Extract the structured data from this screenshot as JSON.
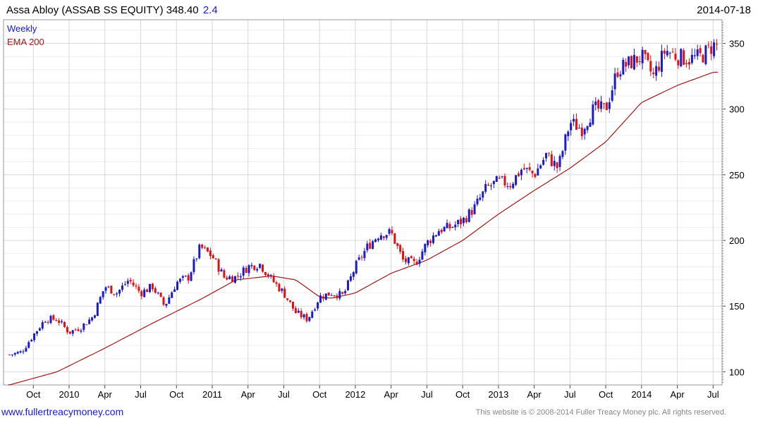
{
  "header": {
    "name": "Assa Abloy (ASSAB SS EQUITY)",
    "price": "348.40",
    "change": "2.4",
    "date": "2014-07-18"
  },
  "footer": {
    "site": "www.fullertreacymoney.com",
    "copyright": "This website is © 2008-2014 Fuller Treacy Money plc. All rights reserved."
  },
  "colors": {
    "up": "#1a1acd",
    "down": "#dd1111",
    "ema": "#a01818",
    "grid": "#d8d8d8"
  },
  "chart_data": {
    "type": "candlestick",
    "legend": [
      {
        "label": "Weekly",
        "color": "#1a1acd"
      },
      {
        "label": "EMA 200",
        "color": "#a01818"
      }
    ],
    "ylim": [
      90,
      368
    ],
    "y_ticks": [
      100,
      150,
      200,
      250,
      300,
      350
    ],
    "x_ticks": [
      "Oct",
      "2010",
      "Apr",
      "Jul",
      "Oct",
      "2011",
      "Apr",
      "Jul",
      "Oct",
      "2012",
      "Apr",
      "Jul",
      "Oct",
      "2013",
      "Apr",
      "Jul",
      "Oct",
      "2014",
      "Apr",
      "Jul"
    ],
    "close_series": [
      {
        "x": "2009-08",
        "y": 113
      },
      {
        "x": "2009-09",
        "y": 115
      },
      {
        "x": "2009-10",
        "y": 128
      },
      {
        "x": "2009-11",
        "y": 140
      },
      {
        "x": "2009-12",
        "y": 140
      },
      {
        "x": "2010-01",
        "y": 130
      },
      {
        "x": "2010-02",
        "y": 134
      },
      {
        "x": "2010-03",
        "y": 142
      },
      {
        "x": "2010-04",
        "y": 165
      },
      {
        "x": "2010-05",
        "y": 160
      },
      {
        "x": "2010-06",
        "y": 170
      },
      {
        "x": "2010-07",
        "y": 160
      },
      {
        "x": "2010-08",
        "y": 165
      },
      {
        "x": "2010-09",
        "y": 150
      },
      {
        "x": "2010-10",
        "y": 168
      },
      {
        "x": "2010-11",
        "y": 172
      },
      {
        "x": "2010-12",
        "y": 195
      },
      {
        "x": "2011-01",
        "y": 188
      },
      {
        "x": "2011-02",
        "y": 172
      },
      {
        "x": "2011-03",
        "y": 172
      },
      {
        "x": "2011-04",
        "y": 180
      },
      {
        "x": "2011-05",
        "y": 182
      },
      {
        "x": "2011-06",
        "y": 170
      },
      {
        "x": "2011-07",
        "y": 160
      },
      {
        "x": "2011-08",
        "y": 145
      },
      {
        "x": "2011-09",
        "y": 140
      },
      {
        "x": "2011-10",
        "y": 157
      },
      {
        "x": "2011-11",
        "y": 160
      },
      {
        "x": "2011-12",
        "y": 158
      },
      {
        "x": "2012-01",
        "y": 180
      },
      {
        "x": "2012-02",
        "y": 195
      },
      {
        "x": "2012-03",
        "y": 205
      },
      {
        "x": "2012-04",
        "y": 206
      },
      {
        "x": "2012-05",
        "y": 185
      },
      {
        "x": "2012-06",
        "y": 182
      },
      {
        "x": "2012-07",
        "y": 198
      },
      {
        "x": "2012-08",
        "y": 208
      },
      {
        "x": "2012-09",
        "y": 210
      },
      {
        "x": "2012-10",
        "y": 215
      },
      {
        "x": "2012-11",
        "y": 225
      },
      {
        "x": "2012-12",
        "y": 240
      },
      {
        "x": "2013-01",
        "y": 245
      },
      {
        "x": "2013-02",
        "y": 243
      },
      {
        "x": "2013-03",
        "y": 255
      },
      {
        "x": "2013-04",
        "y": 250
      },
      {
        "x": "2013-05",
        "y": 265
      },
      {
        "x": "2013-06",
        "y": 255
      },
      {
        "x": "2013-07",
        "y": 290
      },
      {
        "x": "2013-08",
        "y": 285
      },
      {
        "x": "2013-09",
        "y": 300
      },
      {
        "x": "2013-10",
        "y": 300
      },
      {
        "x": "2013-11",
        "y": 330
      },
      {
        "x": "2013-12",
        "y": 335
      },
      {
        "x": "2014-01",
        "y": 340
      },
      {
        "x": "2014-02",
        "y": 325
      },
      {
        "x": "2014-03",
        "y": 345
      },
      {
        "x": "2014-04",
        "y": 340
      },
      {
        "x": "2014-05",
        "y": 338
      },
      {
        "x": "2014-06",
        "y": 340
      },
      {
        "x": "2014-07",
        "y": 348.4
      }
    ],
    "ema_series": [
      {
        "x": "2009-08",
        "y": 90
      },
      {
        "x": "2009-12",
        "y": 100
      },
      {
        "x": "2010-04",
        "y": 118
      },
      {
        "x": "2010-08",
        "y": 137
      },
      {
        "x": "2010-12",
        "y": 155
      },
      {
        "x": "2011-03",
        "y": 170
      },
      {
        "x": "2011-06",
        "y": 173
      },
      {
        "x": "2011-08",
        "y": 170
      },
      {
        "x": "2011-10",
        "y": 157
      },
      {
        "x": "2011-11",
        "y": 156
      },
      {
        "x": "2012-01",
        "y": 160
      },
      {
        "x": "2012-04",
        "y": 175
      },
      {
        "x": "2012-07",
        "y": 185
      },
      {
        "x": "2012-10",
        "y": 200
      },
      {
        "x": "2013-01",
        "y": 220
      },
      {
        "x": "2013-04",
        "y": 238
      },
      {
        "x": "2013-07",
        "y": 255
      },
      {
        "x": "2013-10",
        "y": 275
      },
      {
        "x": "2014-01",
        "y": 305
      },
      {
        "x": "2014-04",
        "y": 318
      },
      {
        "x": "2014-07",
        "y": 328
      }
    ]
  }
}
